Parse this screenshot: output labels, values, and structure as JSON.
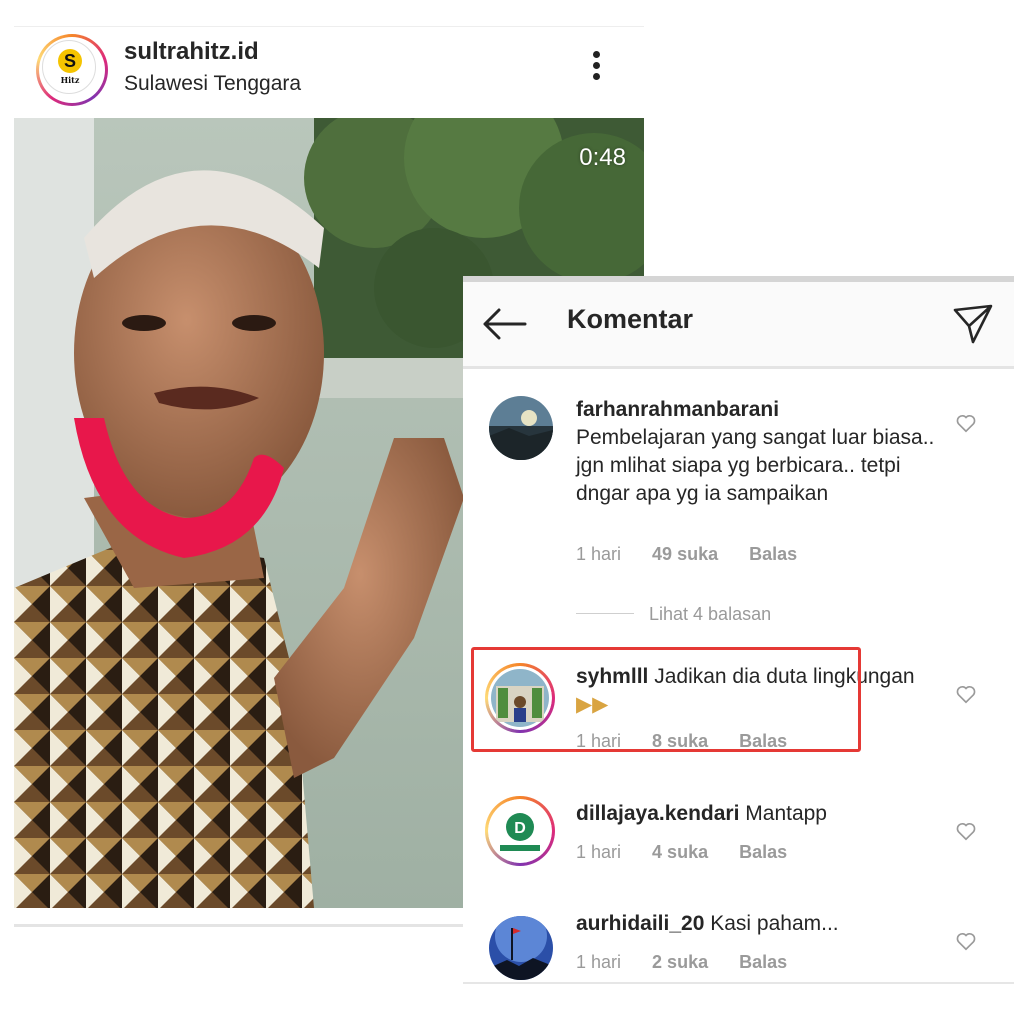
{
  "post": {
    "username": "sultrahitz.id",
    "location": "Sulawesi Tenggara",
    "logo_text": "Hitz",
    "video_time": "0:48"
  },
  "comments_panel": {
    "title": "Komentar",
    "comments": [
      {
        "username": "farhanrahmanbarani",
        "text": "Pembelajaran yang sangat luar biasa.. jgn mlihat siapa yg berbicara.. tetpi dngar apa yg ia sampaikan",
        "time": "1 hari",
        "likes": "49 suka",
        "reply": "Balas",
        "view_replies": "Lihat 4 balasan"
      },
      {
        "username": "syhmlll",
        "text": "Jadikan dia duta lingkungan",
        "time": "1 hari",
        "likes": "8 suka",
        "reply": "Balas",
        "highlighted": true
      },
      {
        "username": "dillajaya.kendari",
        "text": "Mantapp",
        "time": "1 hari",
        "likes": "4 suka",
        "reply": "Balas"
      },
      {
        "username": "aurhidaili_20",
        "text": "Kasi paham...",
        "time": "1 hari",
        "likes": "2 suka",
        "reply": "Balas"
      }
    ]
  },
  "icons": {
    "back": "arrow-left-icon",
    "send": "paper-plane-icon",
    "more": "kebab-menu-icon",
    "like": "heart-outline-icon"
  },
  "colors": {
    "highlight": "#e53935",
    "text": "#262626",
    "muted": "#9a9a9a"
  }
}
